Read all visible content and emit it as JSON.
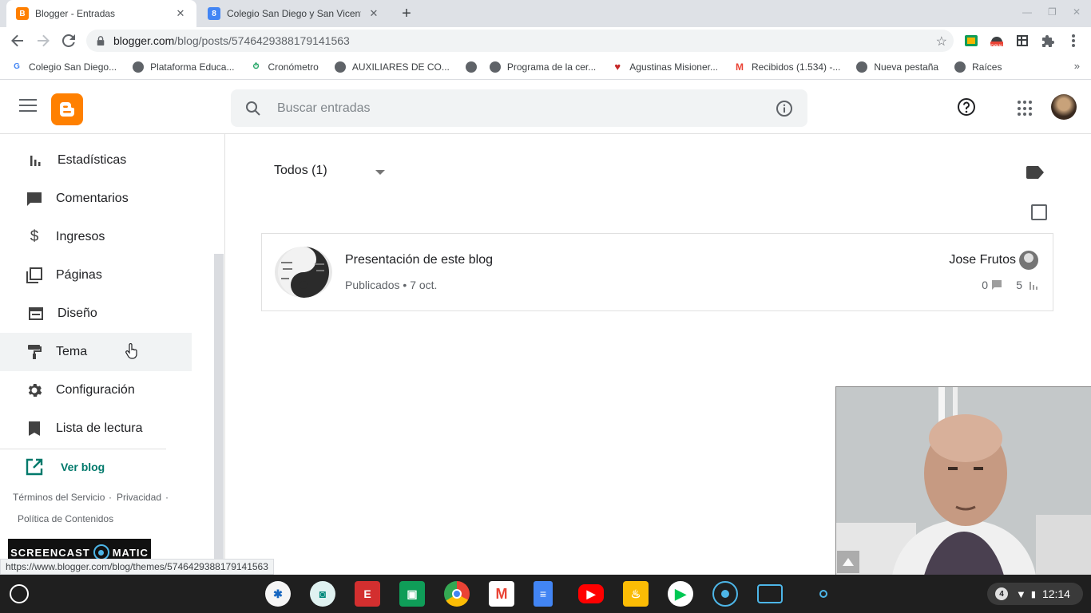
{
  "browser": {
    "tabs": [
      {
        "title": "Blogger - Entradas",
        "favicon": "blogger-icon",
        "active": true
      },
      {
        "title": "Colegio San Diego y San Vicente",
        "favicon": "calendar-icon",
        "active": false
      }
    ],
    "url_domain": "blogger.com",
    "url_path": "/blog/posts/5746429388179141563",
    "bookmarks": [
      {
        "label": "Colegio San Diego...",
        "icon": "google-icon"
      },
      {
        "label": "Plataforma Educa...",
        "icon": "globe-icon"
      },
      {
        "label": "Cronómetro",
        "icon": "clock-icon"
      },
      {
        "label": "AUXILIARES DE CO...",
        "icon": "globe-icon"
      },
      {
        "label": "",
        "icon": "globe-icon"
      },
      {
        "label": "Programa de la cer...",
        "icon": "globe-icon"
      },
      {
        "label": "Agustinas Misioner...",
        "icon": "heart-icon"
      },
      {
        "label": "Recibidos (1.534) -...",
        "icon": "gmail-icon"
      },
      {
        "label": "Nueva pestaña",
        "icon": "globe-icon"
      },
      {
        "label": "Raíces",
        "icon": "globe-icon"
      }
    ],
    "extension_badge": "new",
    "status_url": "https://www.blogger.com/blog/themes/5746429388179141563"
  },
  "header": {
    "search_placeholder": "Buscar entradas"
  },
  "sidebar": {
    "items": [
      {
        "label": "Estadísticas",
        "icon": "stats-icon"
      },
      {
        "label": "Comentarios",
        "icon": "comment-icon"
      },
      {
        "label": "Ingresos",
        "icon": "dollar-icon"
      },
      {
        "label": "Páginas",
        "icon": "pages-icon"
      },
      {
        "label": "Diseño",
        "icon": "layout-icon"
      },
      {
        "label": "Tema",
        "icon": "paint-roller-icon"
      },
      {
        "label": "Configuración",
        "icon": "gear-icon"
      },
      {
        "label": "Lista de lectura",
        "icon": "bookmark-icon"
      }
    ],
    "view_blog": "Ver blog",
    "footer": {
      "terms": "Términos del Servicio",
      "sep": "·",
      "privacy": "Privacidad",
      "sep2": "·",
      "content_policy": "Política de Contenidos"
    },
    "watermark_left": "SCREENCAST",
    "watermark_right": "MATIC"
  },
  "main": {
    "filter_label": "Todos (1)",
    "post": {
      "title": "Presentación de este blog",
      "status": "Publicados",
      "dot": "•",
      "date": "7 oct.",
      "author": "Jose Frutos",
      "comments": "0",
      "views": "5"
    }
  },
  "shelf": {
    "notifications": "4",
    "time": "12:14"
  },
  "colors": {
    "blogger_orange": "#ff8000",
    "link_teal": "#00796b"
  }
}
